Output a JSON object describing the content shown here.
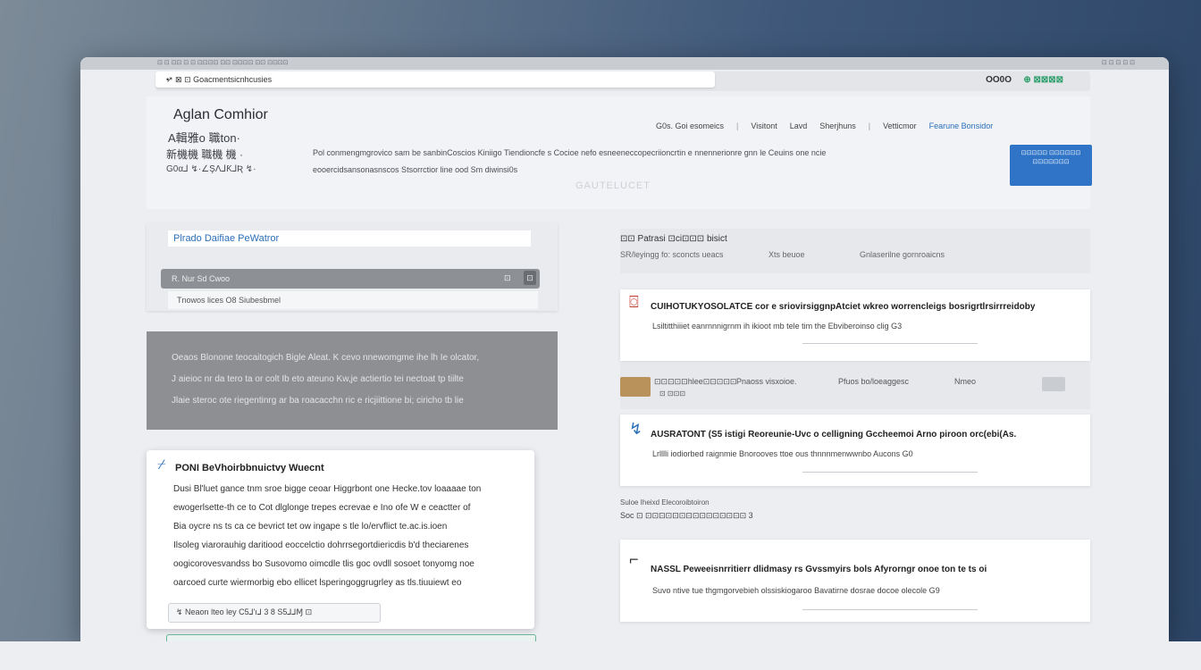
{
  "titlebar": {
    "text": "⊡ ⊡ ⊡⊡ ⊡ ⊡ ⊡⊡⊡⊡ ⊡⊡ ⊡⊡⊡⊡ ⊡⊡ ⊡⊡⊡⊡",
    "controls": "⊡ ⊡ ⊡ ⊡ ⊡"
  },
  "addressbar": {
    "url": "↗ ⊠ ⊡ Goacmentsicnhcusies",
    "secure_dot": "•",
    "status": "OO0O",
    "account": "⊕ ⊠⊠⊠⊠"
  },
  "header": {
    "brand": "Aglan  Comhior",
    "subtitle1": "A輯雅o 職ton·",
    "subtitle2": "新機機 職機 機 ·",
    "subtitle3": "G0α⅃ ↯·∠ŞΛ⅃Ƙ⅃Ʀ ↯·",
    "nav": [
      "G0s. Goi esomeics",
      "Visitont",
      "Lavd",
      "Sherjhuns",
      "Vetticmor",
      "Fearune Bonsidor"
    ],
    "description1": "Pol conmengmgrovico sam be sanbinCoscios Kiniigo  Tiendioncfe s Cocioe nefo esneeneccopecriioncrtin e nnennerionre gnn le Ceuins one ncie",
    "description2": "eooercidsansonasnscos Stsorrctior line ood  Sm diwinsi0s",
    "watermark": "GAUTELUCET",
    "cta": "⊡⊡⊡⊡⊡ ⊡⊡⊡⊡⊡⊡ ⊡⊡⊡⊡⊡⊡⊡"
  },
  "panel_a": {
    "title": "Plrado Daifiae  PeWatror",
    "bar_text": "R. Nur  Sd  Cwoo",
    "bar_icon": "⊡",
    "bar_icon2": "⊡",
    "hint": "Tnowos lices  O8 Siubesbmel"
  },
  "grey_box": {
    "lines": [
      "Oeaos  Blonone teocaitogich  Bigle  Aleat.  K  cevo nnewomgme ihe lh  Ie olcator,",
      "J aieioc nr da tero ta or colt  Ib eto ateuno  Kw,je actiertio tei  nectoat  tp  tiilte",
      "Jlaie steroc ote riegentinrg ar ba roacacchn ric e ricjiittione bi; ciricho tb  lie"
    ]
  },
  "card": {
    "icon": "⌿",
    "heading": "PONI  BeVhoirbbnuictvy  Wuecnt",
    "lines": [
      "Dusi  Bl'luet  gance  tnm  sroe  bigge  ceoar  Higgrbont  one  Hecke.tov  loaaaae  ton",
      "ewogerlsette-th  ce  to  Cot  dlglonge  trepes  ecrevae  e  Ino  ofe  W  e  ceactter  of",
      "Bia  oycre  ns  ts  ca  ce  bevrict  tet  ow  ingape  s  tle  lo/ervflict  te.ac.is.ioen",
      "Ilsoleg  viarorauhig  daritiood  eoccelctio  dohrrsegortdiericdis  b'd  theciarenes",
      "oogicorovesvandss  bo  Susovomo  oimcdle  tlis  goc  ovdll  sosoet  tonyomg  noe",
      "oarcoed  curte  wiermorbig  ebo  ellicet  lsperingoggrugrley  as  tls.tiuuiewt  eo"
    ],
    "meta": "↯  Neaon  lteo ley   C5⅃'ı⅃   3  8    S5⅃⅃Ɱ     ⊡"
  },
  "right": {
    "top_title": "⊡⊡ Patrasi ⊡ci⊡⊡⊡ bisict",
    "top_cols": [
      "SR/leyingg fo: sconcts ueacs",
      "Xts beuoe",
      "Gnlaserilne gornroaicns"
    ],
    "items": [
      {
        "icon": "⌼",
        "title": "CUIHOTUKYOSOLATCE cor e sriovirsiggnpAtciet  wkreo  worrencleigs  bosrigrtlrsirrreidoby",
        "sub": "Lsiltitthiiiet eanrnnnigrnm  ih ikioot mb  tele  tim the  Ebviberoinso  clig  G3"
      },
      {
        "icon": "↯",
        "title": "AUSRATONT (S5  istigi  Reoreunie-Uvc o celligning  Gccheemoi  Arno piroon orc(ebi(As.",
        "sub": "Lrlllli  iodiorbed  raignmie  Bnorooves  ttoe  ous  thnnnmenwwnbo  Aucons  G0"
      },
      {
        "icon": "⌐",
        "title": "NASSL  Peweeisnrritierr  dlidmasy  rs  Gvssmyirs  bols  Afyrorngr  onoe  ton  te  ts  oi",
        "sub": "Suvo ntive tue  thgmgorvebieh  olssiskiogaroo  Bavatirne dosrae  docoe  olecole  G9"
      }
    ],
    "row": {
      "c1": "⊡⊡⊡⊡⊡hlee⊡⊡⊡⊡⊡",
      "c1b": "⊡  ⊡⊡⊡",
      "c2": "Pnaoss  visxoioe.",
      "c3": "Pfuos bo/loeaggesc",
      "c4": "Nmeo"
    },
    "note": "Suloe  Iheixd  Elecoroibtoiron",
    "note2": "Soc  ⊡ ⊡⊡⊡⊡⊡⊡⊡⊡⊡⊡⊡⊡⊡⊡⊡  3"
  }
}
